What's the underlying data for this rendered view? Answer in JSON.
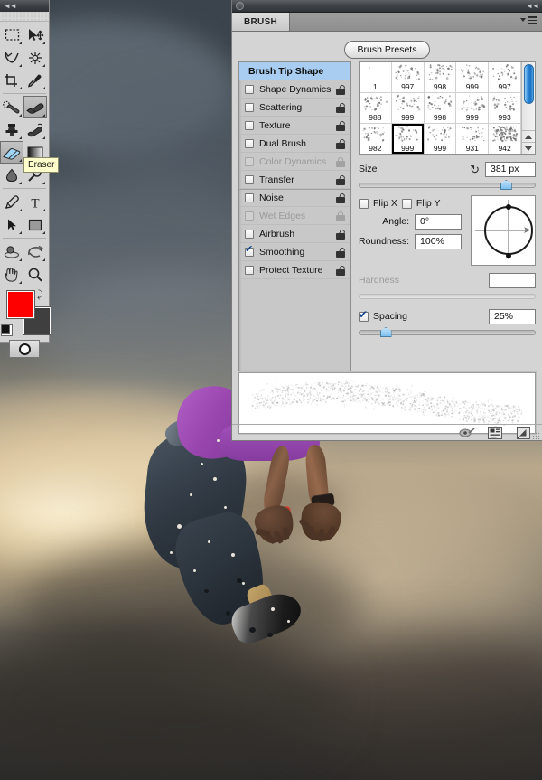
{
  "toolbar": {
    "collapse_icon": "collapse-left-arrows",
    "tools": [
      [
        {
          "name": "rectangular-marquee-tool",
          "icon": "marquee",
          "selected": false,
          "has_more": true
        },
        {
          "name": "move-tool",
          "icon": "move",
          "selected": false,
          "has_more": true
        }
      ],
      [
        {
          "name": "lasso-tool",
          "icon": "lasso",
          "selected": false,
          "has_more": true
        },
        {
          "name": "magic-wand-tool",
          "icon": "magic-wand",
          "selected": false,
          "has_more": true
        }
      ],
      [
        {
          "name": "crop-tool",
          "icon": "crop",
          "selected": false,
          "has_more": true
        },
        {
          "name": "eyedropper-tool",
          "icon": "eyedropper",
          "selected": false,
          "has_more": true
        }
      ],
      [
        {
          "name": "healing-brush-tool",
          "icon": "healing-brush",
          "selected": false,
          "has_more": true
        },
        {
          "name": "brush-tool",
          "icon": "brush",
          "selected": true,
          "has_more": true
        }
      ],
      [
        {
          "name": "clone-stamp-tool",
          "icon": "clone-stamp",
          "selected": false,
          "has_more": true
        },
        {
          "name": "history-brush-tool",
          "icon": "history-brush",
          "selected": false,
          "has_more": true
        }
      ],
      [
        {
          "name": "eraser-tool",
          "icon": "eraser",
          "selected": true,
          "has_more": true
        },
        {
          "name": "gradient-tool",
          "icon": "gradient",
          "selected": false,
          "has_more": true
        }
      ],
      [
        {
          "name": "blur-tool",
          "icon": "blur-drop",
          "selected": false,
          "has_more": true
        },
        {
          "name": "dodge-tool",
          "icon": "dodge",
          "selected": false,
          "has_more": true
        }
      ],
      [
        {
          "name": "pen-tool",
          "icon": "pen",
          "selected": false,
          "has_more": true
        },
        {
          "name": "type-tool",
          "icon": "type-T",
          "selected": false,
          "has_more": true
        }
      ],
      [
        {
          "name": "path-selection-tool",
          "icon": "path-arrow",
          "selected": false,
          "has_more": true
        },
        {
          "name": "shape-tool",
          "icon": "rectangle-shape",
          "selected": false,
          "has_more": true
        }
      ],
      [
        {
          "name": "3d-rotate-tool",
          "icon": "3d-object-rotate",
          "selected": false,
          "has_more": true
        },
        {
          "name": "3d-orbit-tool",
          "icon": "3d-camera-orbit",
          "selected": false,
          "has_more": true
        }
      ],
      [
        {
          "name": "hand-tool",
          "icon": "hand",
          "selected": false,
          "has_more": true
        },
        {
          "name": "zoom-tool",
          "icon": "magnifier",
          "selected": false,
          "has_more": false
        }
      ]
    ],
    "tooltip": "Eraser",
    "foreground_color": "#fe0000",
    "background_color": "#3f3f3f",
    "swap_icon": "swap-colors-icon",
    "default_colors_icon": "default-colors-icon",
    "quick_mask_icon": "quick-mask-icon"
  },
  "panel": {
    "title_dot_icon": "panel-collapse-dot",
    "collapse_icon": "collapse-right-arrows",
    "menu_icon": "panel-menu-icon",
    "tab_label": "BRUSH",
    "presets_button": "Brush Presets",
    "options": [
      {
        "label": "Brush Tip Shape",
        "type": "header",
        "checked": false,
        "disabled": false,
        "lock": false
      },
      {
        "label": "Shape Dynamics",
        "type": "item",
        "checked": false,
        "disabled": false,
        "lock": "open"
      },
      {
        "label": "Scattering",
        "type": "item",
        "checked": false,
        "disabled": false,
        "lock": "open"
      },
      {
        "label": "Texture",
        "type": "item",
        "checked": false,
        "disabled": false,
        "lock": "open"
      },
      {
        "label": "Dual Brush",
        "type": "item",
        "checked": false,
        "disabled": false,
        "lock": "open"
      },
      {
        "label": "Color Dynamics",
        "type": "item",
        "checked": false,
        "disabled": true,
        "lock": "closed"
      },
      {
        "label": "Transfer",
        "type": "item",
        "checked": false,
        "disabled": false,
        "lock": "open"
      },
      {
        "label": "Noise",
        "type": "item-gap",
        "checked": false,
        "disabled": false,
        "lock": "open"
      },
      {
        "label": "Wet Edges",
        "type": "item",
        "checked": false,
        "disabled": true,
        "lock": "closed"
      },
      {
        "label": "Airbrush",
        "type": "item",
        "checked": false,
        "disabled": false,
        "lock": "open"
      },
      {
        "label": "Smoothing",
        "type": "item",
        "checked": true,
        "disabled": false,
        "lock": "open"
      },
      {
        "label": "Protect Texture",
        "type": "item",
        "checked": false,
        "disabled": false,
        "lock": "open"
      }
    ],
    "brush_grid": [
      {
        "number": "1",
        "selected": false
      },
      {
        "number": "997",
        "selected": false
      },
      {
        "number": "998",
        "selected": false
      },
      {
        "number": "999",
        "selected": false
      },
      {
        "number": "997",
        "selected": false
      },
      {
        "number": "988",
        "selected": false
      },
      {
        "number": "999",
        "selected": false
      },
      {
        "number": "998",
        "selected": false
      },
      {
        "number": "999",
        "selected": false
      },
      {
        "number": "993",
        "selected": false
      },
      {
        "number": "982",
        "selected": false
      },
      {
        "number": "999",
        "selected": true
      },
      {
        "number": "999",
        "selected": false
      },
      {
        "number": "931",
        "selected": false
      },
      {
        "number": "942",
        "selected": false
      }
    ],
    "scrollbar": {
      "name": "brush-grid-scrollbar",
      "up_icon": "scroll-up-arrow",
      "down_icon": "scroll-down-arrow"
    },
    "size": {
      "label": "Size",
      "value": "381 px",
      "reset_icon": "reset-size-icon",
      "slider_percent": 80
    },
    "flip_x": {
      "label": "Flip X",
      "checked": false
    },
    "flip_y": {
      "label": "Flip Y",
      "checked": false
    },
    "angle": {
      "label": "Angle:",
      "value": "0°"
    },
    "roundness": {
      "label": "Roundness:",
      "value": "100%"
    },
    "hardness": {
      "label": "Hardness",
      "value": "",
      "disabled": true
    },
    "spacing": {
      "label": "Spacing",
      "value": "25%",
      "checked": true,
      "slider_percent": 12
    },
    "dial": {
      "name": "angle-roundness-dial"
    },
    "preview_label": "brush-stroke-preview",
    "footer_icons": [
      {
        "name": "toggle-live-tip-brush-preview-icon"
      },
      {
        "name": "open-preset-manager-icon"
      },
      {
        "name": "create-new-brush-icon"
      }
    ]
  }
}
